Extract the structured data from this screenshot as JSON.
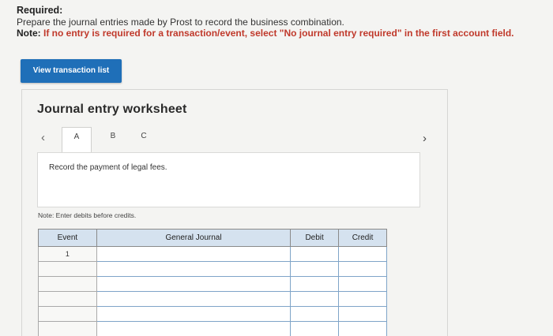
{
  "header": {
    "required_label": "Required:",
    "instruction": "Prepare the journal entries made by Prost to record the business combination.",
    "note_prefix": "Note:",
    "note_text": "If no entry is required for a transaction/event, select \"No journal entry required\" in the first account field."
  },
  "view_button_label": "View transaction list",
  "worksheet": {
    "title": "Journal entry worksheet",
    "nav_left_icon": "chevron-left-icon",
    "nav_right_icon": "chevron-right-icon",
    "tabs": [
      {
        "label": "A",
        "active": true
      },
      {
        "label": "B",
        "active": false
      },
      {
        "label": "C",
        "active": false
      }
    ],
    "description": "Record the payment of legal fees.",
    "debit_note": "Note: Enter debits before credits."
  },
  "table": {
    "columns": [
      "Event",
      "General Journal",
      "Debit",
      "Credit"
    ],
    "rows": [
      {
        "event": "1",
        "account": "",
        "debit": "",
        "credit": ""
      },
      {
        "event": "",
        "account": "",
        "debit": "",
        "credit": ""
      },
      {
        "event": "",
        "account": "",
        "debit": "",
        "credit": ""
      },
      {
        "event": "",
        "account": "",
        "debit": "",
        "credit": ""
      },
      {
        "event": "",
        "account": "",
        "debit": "",
        "credit": ""
      },
      {
        "event": "",
        "account": "",
        "debit": "",
        "credit": ""
      }
    ]
  },
  "colors": {
    "button_bg": "#1f6fb8",
    "note_red": "#c0392b",
    "table_header_bg": "#d5e2ef"
  }
}
